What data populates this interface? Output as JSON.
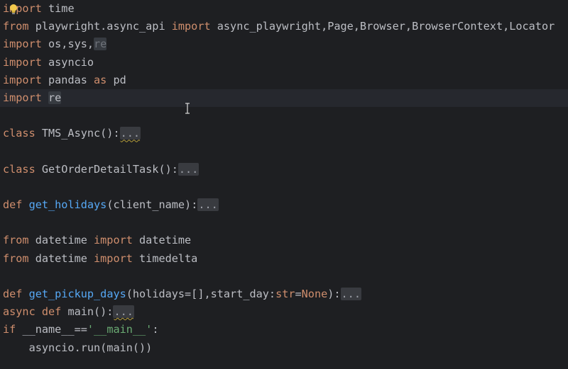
{
  "editor": {
    "lines": [
      [
        {
          "c": "kw",
          "t": "import"
        },
        {
          "c": "plain",
          "t": " time"
        }
      ],
      [
        {
          "c": "kw",
          "t": "from"
        },
        {
          "c": "plain",
          "t": " playwright.async_api "
        },
        {
          "c": "kw",
          "t": "import"
        },
        {
          "c": "plain",
          "t": " async_playwright,Page,Browser,BrowserContext,Locator"
        }
      ],
      [
        {
          "c": "kw",
          "t": "import"
        },
        {
          "c": "plain",
          "t": " os,sys,"
        },
        {
          "c": "dim hl-ref",
          "t": "re"
        }
      ],
      [
        {
          "c": "kw",
          "t": "import"
        },
        {
          "c": "plain",
          "t": " asyncio"
        }
      ],
      [
        {
          "c": "kw",
          "t": "import"
        },
        {
          "c": "plain",
          "t": " pandas "
        },
        {
          "c": "kw",
          "t": "as"
        },
        {
          "c": "plain",
          "t": " pd"
        }
      ],
      [
        {
          "c": "kw",
          "t": "import"
        },
        {
          "c": "plain",
          "t": " "
        },
        {
          "c": "plain hl-ref",
          "t": "re"
        }
      ],
      [],
      [
        {
          "c": "kw",
          "t": "class"
        },
        {
          "c": "plain",
          "t": " TMS_Async():"
        },
        {
          "c": "fold warn",
          "t": "..."
        }
      ],
      [],
      [
        {
          "c": "kw",
          "t": "class"
        },
        {
          "c": "plain",
          "t": " GetOrderDetailTask():"
        },
        {
          "c": "fold",
          "t": "..."
        }
      ],
      [],
      [
        {
          "c": "kw",
          "t": "def"
        },
        {
          "c": "plain",
          "t": " "
        },
        {
          "c": "fn",
          "t": "get_holidays"
        },
        {
          "c": "plain",
          "t": "(client_name):"
        },
        {
          "c": "fold",
          "t": "..."
        }
      ],
      [],
      [
        {
          "c": "kw",
          "t": "from"
        },
        {
          "c": "plain",
          "t": " datetime "
        },
        {
          "c": "kw",
          "t": "import"
        },
        {
          "c": "plain",
          "t": " datetime"
        }
      ],
      [
        {
          "c": "kw",
          "t": "from"
        },
        {
          "c": "plain",
          "t": " datetime "
        },
        {
          "c": "kw",
          "t": "import"
        },
        {
          "c": "plain",
          "t": " timedelta"
        }
      ],
      [],
      [
        {
          "c": "kw",
          "t": "def"
        },
        {
          "c": "plain",
          "t": " "
        },
        {
          "c": "fn",
          "t": "get_pickup_days"
        },
        {
          "c": "plain",
          "t": "(holidays=[],start_day:"
        },
        {
          "c": "kw",
          "t": "str"
        },
        {
          "c": "plain",
          "t": "="
        },
        {
          "c": "kw",
          "t": "None"
        },
        {
          "c": "plain",
          "t": "):"
        },
        {
          "c": "fold",
          "t": "..."
        }
      ],
      [
        {
          "c": "kw",
          "t": "async def"
        },
        {
          "c": "plain",
          "t": " main():"
        },
        {
          "c": "fold warn",
          "t": "..."
        }
      ],
      [
        {
          "c": "kw",
          "t": "if"
        },
        {
          "c": "plain",
          "t": " __name__=="
        },
        {
          "c": "str",
          "t": "'__main__'"
        },
        {
          "c": "plain",
          "t": ":"
        }
      ],
      [
        {
          "c": "plain",
          "t": "    asyncio.run(main())"
        }
      ]
    ],
    "current_line": 5,
    "colors": {
      "background": "#1e1f22",
      "keyword": "#cf8e6d",
      "function": "#56a8f5",
      "string": "#6aab73",
      "text": "#bcbec4"
    },
    "icons": {
      "gutter": "lightbulb-icon",
      "cursor": "text-cursor-icon"
    }
  }
}
